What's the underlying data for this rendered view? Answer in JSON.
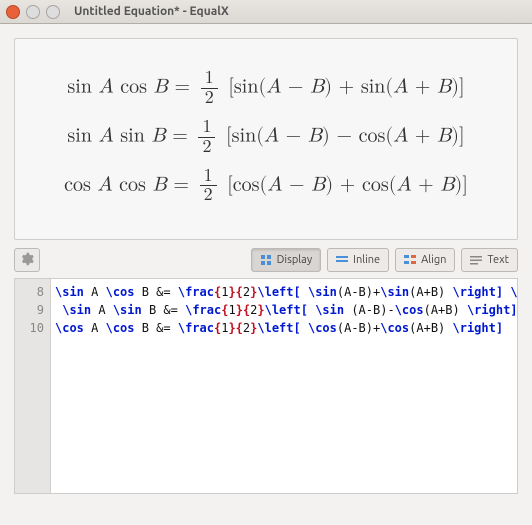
{
  "window": {
    "title": "Untitled Equation* - EqualX"
  },
  "toolbar": {
    "display_label": "Display",
    "inline_label": "Inline",
    "align_label": "Align",
    "text_label": "Text"
  },
  "preview": {
    "eq1_lhs": "sin A cos B",
    "eq1_rhs": "[sin(A − B) + sin(A + B)]",
    "eq2_lhs": "sin A sin B",
    "eq2_rhs": "[sin(A − B) − cos(A + B)]",
    "eq3_lhs": "cos A cos B",
    "eq3_rhs": "[cos(A − B) + cos(A + B)]",
    "frac_num": "1",
    "frac_den": "2"
  },
  "editor": {
    "line_numbers": [
      "8",
      "9",
      "10"
    ],
    "lines": [
      [
        {
          "t": "cmd",
          "s": "\\sin"
        },
        {
          "t": "text",
          "s": " A "
        },
        {
          "t": "cmd",
          "s": "\\cos"
        },
        {
          "t": "text",
          "s": " B &= "
        },
        {
          "t": "cmd",
          "s": "\\frac"
        },
        {
          "t": "brace",
          "s": "{"
        },
        {
          "t": "text",
          "s": "1"
        },
        {
          "t": "brace",
          "s": "}{"
        },
        {
          "t": "text",
          "s": "2"
        },
        {
          "t": "brace",
          "s": "}"
        },
        {
          "t": "cmd",
          "s": "\\left["
        },
        {
          "t": "text",
          "s": " "
        },
        {
          "t": "cmd",
          "s": "\\sin"
        },
        {
          "t": "text",
          "s": "(A-B)+"
        },
        {
          "t": "cmd",
          "s": "\\sin"
        },
        {
          "t": "text",
          "s": "(A+B) "
        },
        {
          "t": "cmd",
          "s": "\\right]"
        },
        {
          "t": "text",
          "s": " "
        },
        {
          "t": "cmd",
          "s": "\\\\"
        }
      ],
      [
        {
          "t": "text",
          "s": " "
        },
        {
          "t": "cmd",
          "s": "\\sin"
        },
        {
          "t": "text",
          "s": " A "
        },
        {
          "t": "cmd",
          "s": "\\sin"
        },
        {
          "t": "text",
          "s": " B &= "
        },
        {
          "t": "cmd",
          "s": "\\frac"
        },
        {
          "t": "brace",
          "s": "{"
        },
        {
          "t": "text",
          "s": "1"
        },
        {
          "t": "brace",
          "s": "}{"
        },
        {
          "t": "text",
          "s": "2"
        },
        {
          "t": "brace",
          "s": "}"
        },
        {
          "t": "cmd",
          "s": "\\left["
        },
        {
          "t": "text",
          "s": " "
        },
        {
          "t": "cmd",
          "s": "\\sin"
        },
        {
          "t": "text",
          "s": " (A-B)-"
        },
        {
          "t": "cmd",
          "s": "\\cos"
        },
        {
          "t": "text",
          "s": "(A+B) "
        },
        {
          "t": "cmd",
          "s": "\\right]"
        },
        {
          "t": "text",
          "s": " "
        },
        {
          "t": "cmd",
          "s": "\\\\"
        }
      ],
      [
        {
          "t": "cmd",
          "s": "\\cos"
        },
        {
          "t": "text",
          "s": " A "
        },
        {
          "t": "cmd",
          "s": "\\cos"
        },
        {
          "t": "text",
          "s": " B &= "
        },
        {
          "t": "cmd",
          "s": "\\frac"
        },
        {
          "t": "brace",
          "s": "{"
        },
        {
          "t": "text",
          "s": "1"
        },
        {
          "t": "brace",
          "s": "}{"
        },
        {
          "t": "text",
          "s": "2"
        },
        {
          "t": "brace",
          "s": "}"
        },
        {
          "t": "cmd",
          "s": "\\left["
        },
        {
          "t": "text",
          "s": " "
        },
        {
          "t": "cmd",
          "s": "\\cos"
        },
        {
          "t": "text",
          "s": "(A-B)+"
        },
        {
          "t": "cmd",
          "s": "\\cos"
        },
        {
          "t": "text",
          "s": "(A+B) "
        },
        {
          "t": "cmd",
          "s": "\\right]"
        }
      ]
    ]
  }
}
